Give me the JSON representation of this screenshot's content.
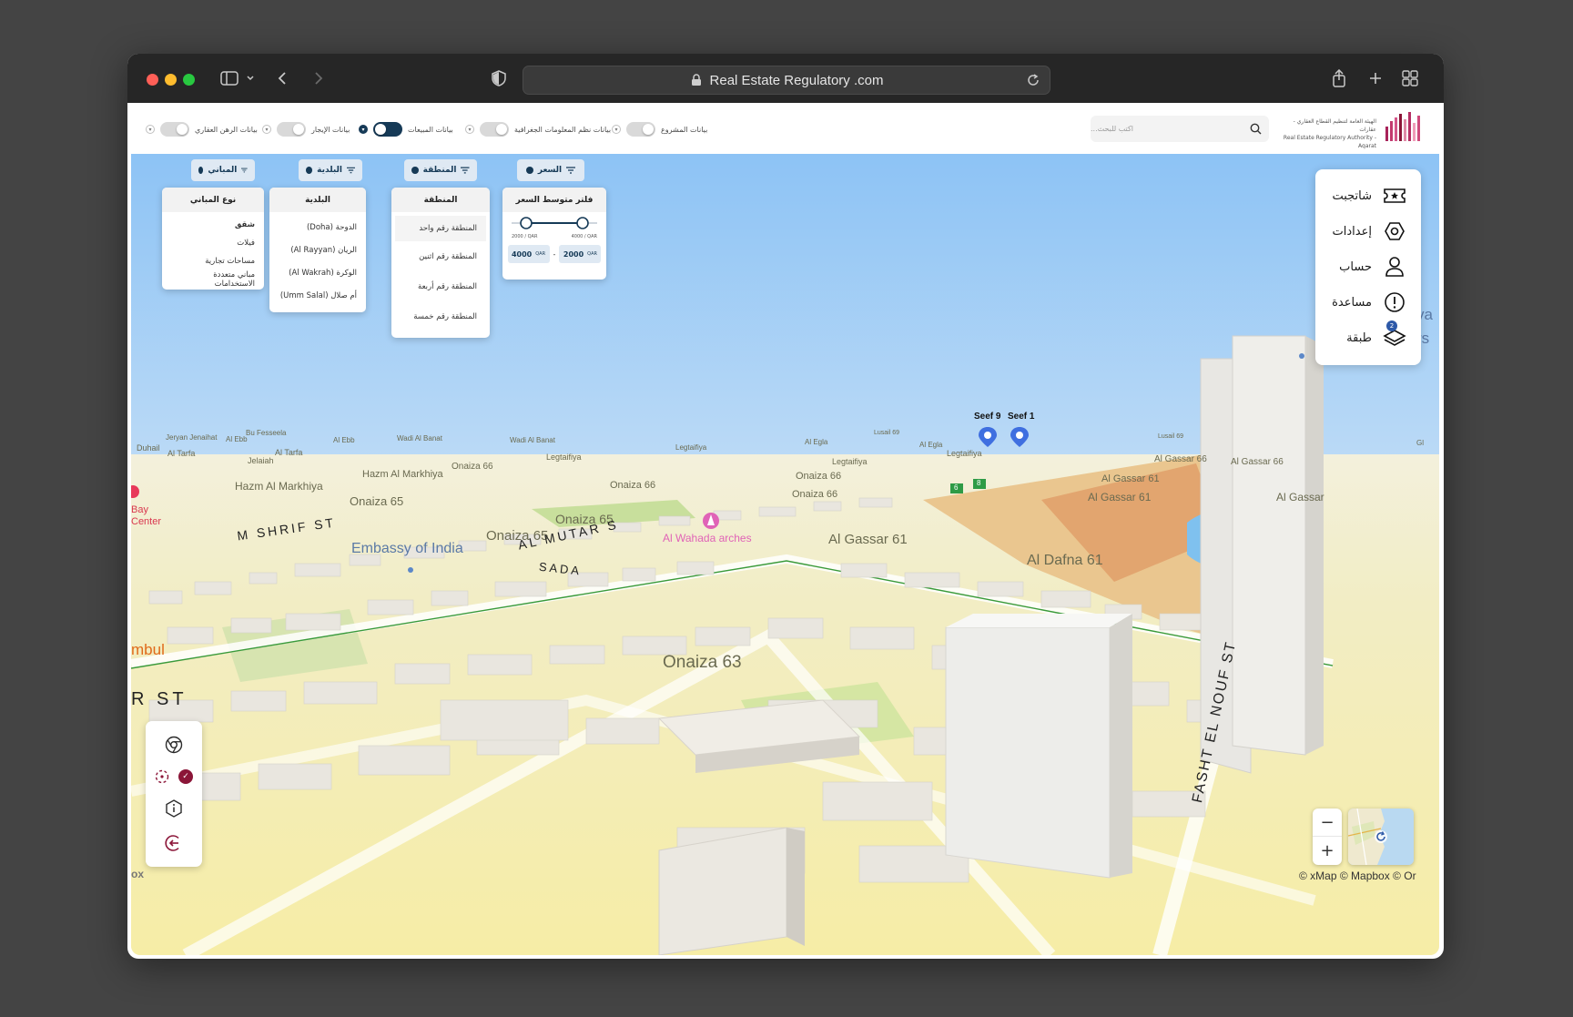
{
  "browser": {
    "url": "Real Estate Regulatory .com"
  },
  "colors": {
    "brand_dark": "#163a57",
    "accent_maroon": "#8b1538",
    "poi_pink": "#e063b7",
    "pin_blue": "#3f6fe0"
  },
  "header": {
    "logo_line1": "الهيئة العامة لتنظيم القطاع العقاري - عقارات",
    "logo_line2": "Real Estate Regulatory Authority - Aqarat",
    "search_placeholder": "اكتب للبحث...",
    "toggles": [
      {
        "label": "بيانات المشروع",
        "on": false
      },
      {
        "label": "بيانات نظم المعلومات الجغرافية",
        "on": false
      },
      {
        "label": "بيانات المبيعات",
        "on": true
      },
      {
        "label": "بيانات الإيجار",
        "on": false
      },
      {
        "label": "بيانات الرهن العقاري",
        "on": false
      }
    ]
  },
  "filters": {
    "price": {
      "button": "السعر",
      "title": "فلتر متوسط السعر",
      "min_tick": "2000 / QAR",
      "max_tick": "4000 / QAR",
      "from_value": "2000",
      "to_value": "4000",
      "currency": "QAR",
      "separator": "-"
    },
    "zone": {
      "button": "المنطقة",
      "title": "المنطقة",
      "items": [
        "المنطقة رقم واحد",
        "المنطقة رقم اثنين",
        "المنطقة رقم أربعة",
        "المنطقة رقم خمسة"
      ]
    },
    "municipality": {
      "button": "البلدية",
      "title": "البلدية",
      "items": [
        "الدوحة (Doha)",
        "الريان (Al Rayyan)",
        "الوكرة (Al Wakrah)",
        "أم صلال (Umm Salal)"
      ]
    },
    "buildings": {
      "button": "المباني",
      "title": "نوع المباني",
      "items": [
        "شقق",
        "فيلات",
        "مساحات تجارية",
        "مباني متعددة الاستخدامات"
      ]
    }
  },
  "sidebar": {
    "items": [
      {
        "label": "شاتجبت",
        "icon": "ticket-star-icon"
      },
      {
        "label": "إعدادات",
        "icon": "settings-hexagon-icon"
      },
      {
        "label": "حساب",
        "icon": "user-icon"
      },
      {
        "label": "مساعدة",
        "icon": "help-exclamation-icon"
      },
      {
        "label": "طبقة",
        "icon": "layers-icon",
        "badge": "2"
      }
    ]
  },
  "map": {
    "labels": {
      "duhail": "Duhail",
      "jeryan": "Jeryan Jenaihat",
      "al_ebb1": "Al Ebb",
      "bu_fesseela": "Bu Fesseela",
      "al_ebb2": "Al Ebb",
      "wadi_banat1": "Wadi Al Banat",
      "wadi_banat2": "Wadi Al Banat",
      "legtaifiya1": "Legtaifiya",
      "al_egla1": "Al Egla",
      "lusail1": "Lusail 69",
      "al_egla2": "Al Egla",
      "lusail2": "Lusail 69",
      "gl": "Gl",
      "al_tarfa1": "Al Tarfa",
      "jelaiah": "Jelaiah",
      "al_tarfa2": "Al Tarfa",
      "legtaifiya2": "Legtaifiya",
      "legtaifiya3": "Legtaifiya",
      "legtaifiya4": "Legtaifiya",
      "al_gassar66a": "Al Gassar 66",
      "al_gassar66b": "Al Gassar 66",
      "hazm1": "Hazm Al Markhiya",
      "onaiza66a": "Onaiza 66",
      "onaiza66b": "Onaiza 66",
      "onaiza66c": "Onaiza 66",
      "onaiza66d": "Onaiza 66",
      "al_gassar61a": "Al Gassar 61",
      "al_gassar61b": "Al Gassar 61",
      "al_gassar": "Al Gassar",
      "hazm2": "Hazm Al Markhiya",
      "onaiza65a": "Onaiza 65",
      "onaiza65b": "Onaiza 65",
      "onaiza65c": "Onaiza 65",
      "bay": "Bay",
      "center": "Center",
      "embassy": "Embassy of India",
      "al_wahada": "Al Wahada arches",
      "al_gassar61c": "Al Gassar 61",
      "al_dafna": "Al Dafna 61",
      "onaiza63": "Onaiza 63",
      "mshrif": "M  SHRIF ST",
      "almutar": "AL MUTAR S",
      "sada": "S A D A",
      "fasht": "FASHT EL NOUF ST",
      "r_st": "R ST",
      "mbul": "mbul",
      "ya": "ya",
      "rs": "rs",
      "seef9": "Seef 9",
      "seef1": "Seef 1",
      "route6": "6",
      "route8": "8"
    },
    "attribution": "© xMap © Mapbox © Or",
    "logo_fragment": "ox",
    "zoom_in": "+",
    "zoom_out": "−"
  }
}
